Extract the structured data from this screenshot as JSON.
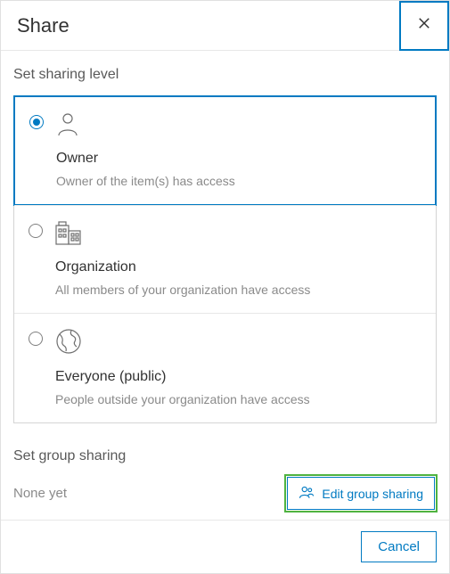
{
  "header": {
    "title": "Share"
  },
  "sections": {
    "level_title": "Set sharing level",
    "group_title": "Set group sharing"
  },
  "options": {
    "owner": {
      "label": "Owner",
      "desc": "Owner of the item(s) has access",
      "selected": true
    },
    "org": {
      "label": "Organization",
      "desc": "All members of your organization have access",
      "selected": false
    },
    "public": {
      "label": "Everyone (public)",
      "desc": "People outside your organization have access",
      "selected": false
    }
  },
  "group": {
    "status": "None yet",
    "edit_label": "Edit group sharing"
  },
  "footer": {
    "cancel": "Cancel"
  }
}
